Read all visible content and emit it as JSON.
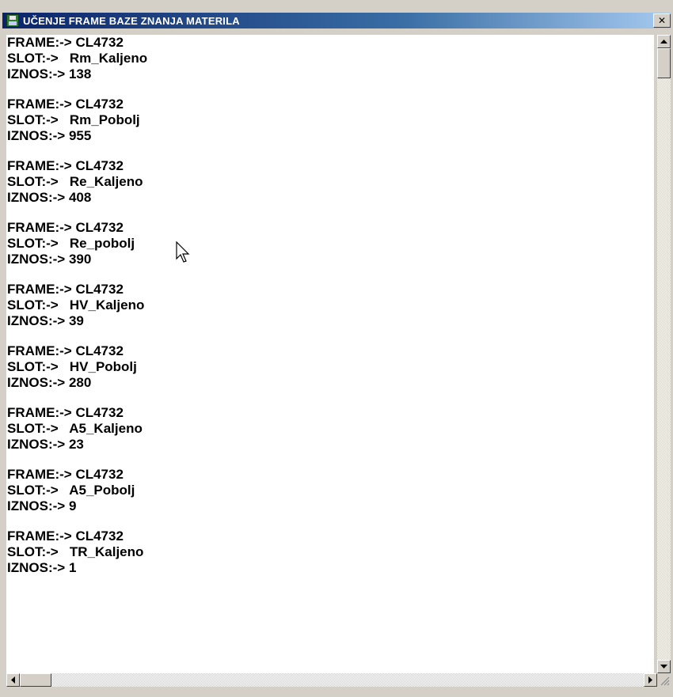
{
  "window": {
    "title": "UČENJE FRAME BAZE ZNANJA MATERILA",
    "icon": "floppy-disk-icon",
    "close_glyph": "✕"
  },
  "records": [
    {
      "frame_label": "FRAME:->",
      "frame": "CL4732",
      "slot_label": "SLOT:->",
      "slot": "Rm_Kaljeno",
      "amount_label": "IZNOS:->",
      "amount": "138"
    },
    {
      "frame_label": "FRAME:->",
      "frame": "CL4732",
      "slot_label": "SLOT:->",
      "slot": "Rm_Pobolj",
      "amount_label": "IZNOS:->",
      "amount": "955"
    },
    {
      "frame_label": "FRAME:->",
      "frame": "CL4732",
      "slot_label": "SLOT:->",
      "slot": "Re_Kaljeno",
      "amount_label": "IZNOS:->",
      "amount": "408"
    },
    {
      "frame_label": "FRAME:->",
      "frame": "CL4732",
      "slot_label": "SLOT:->",
      "slot": "Re_pobolj",
      "amount_label": "IZNOS:->",
      "amount": "390"
    },
    {
      "frame_label": "FRAME:->",
      "frame": "CL4732",
      "slot_label": "SLOT:->",
      "slot": "HV_Kaljeno",
      "amount_label": "IZNOS:->",
      "amount": "39"
    },
    {
      "frame_label": "FRAME:->",
      "frame": "CL4732",
      "slot_label": "SLOT:->",
      "slot": "HV_Pobolj",
      "amount_label": "IZNOS:->",
      "amount": "280"
    },
    {
      "frame_label": "FRAME:->",
      "frame": "CL4732",
      "slot_label": "SLOT:->",
      "slot": "A5_Kaljeno",
      "amount_label": "IZNOS:->",
      "amount": "23"
    },
    {
      "frame_label": "FRAME:->",
      "frame": "CL4732",
      "slot_label": "SLOT:->",
      "slot": "A5_Pobolj",
      "amount_label": "IZNOS:->",
      "amount": "9"
    },
    {
      "frame_label": "FRAME:->",
      "frame": "CL4732",
      "slot_label": "SLOT:->",
      "slot": "TR_Kaljeno",
      "amount_label": "IZNOS:->",
      "amount": "1"
    }
  ],
  "colors": {
    "title_start": "#0a246a",
    "title_end": "#a6caf0",
    "face": "#d4d0c8",
    "text": "#000000"
  }
}
